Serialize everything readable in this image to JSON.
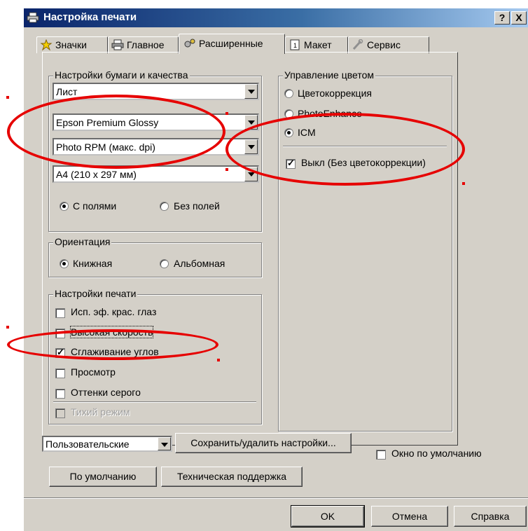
{
  "window": {
    "title": "Настройка печати",
    "help_btn": "?",
    "close_btn": "X"
  },
  "tabs": [
    {
      "label": "Значки",
      "icon": "star-icon"
    },
    {
      "label": "Главное",
      "icon": "printer-icon"
    },
    {
      "label": "Расширенные",
      "icon": "gears-icon",
      "active": true
    },
    {
      "label": "Макет",
      "icon": "page-icon"
    },
    {
      "label": "Сервис",
      "icon": "wrench-icon"
    }
  ],
  "paper_group": {
    "title": "Настройки бумаги и качества",
    "source": "Лист",
    "media": "Epson Premium Glossy",
    "quality": "Photo RPM (макс. dpi)",
    "size": "A4 (210 x 297 мм)",
    "border_on": "С полями",
    "border_off": "Без полей"
  },
  "orientation": {
    "title": "Ориентация",
    "portrait": "Книжная",
    "landscape": "Альбомная"
  },
  "print_settings": {
    "title": "Настройки печати",
    "red_eye": "Исп. эф. крас. глаз",
    "high_speed": "Высокая скорость",
    "edge_smooth": "Сглаживание углов",
    "preview": "Просмотр",
    "grayscale": "Оттенки серого",
    "quiet": "Тихий режим"
  },
  "color_mgmt": {
    "title": "Управление цветом",
    "color_controls": "Цветокоррекция",
    "photo_enhance": "PhotoEnhance",
    "icm": "ICM",
    "off_no_correction": "Выкл (Без цветокоррекции)"
  },
  "bottom": {
    "preset": "Пользовательские",
    "save_delete": "Сохранить/удалить настройки...",
    "default_window": "Окно по умолчанию",
    "defaults": "По умолчанию",
    "tech_support": "Техническая поддержка"
  },
  "footer": {
    "ok": "OK",
    "cancel": "Отмена",
    "help": "Справка"
  },
  "colors": {
    "annotation": "#e60000",
    "titlebar": "#0a246a",
    "face": "#d4d0c8"
  }
}
